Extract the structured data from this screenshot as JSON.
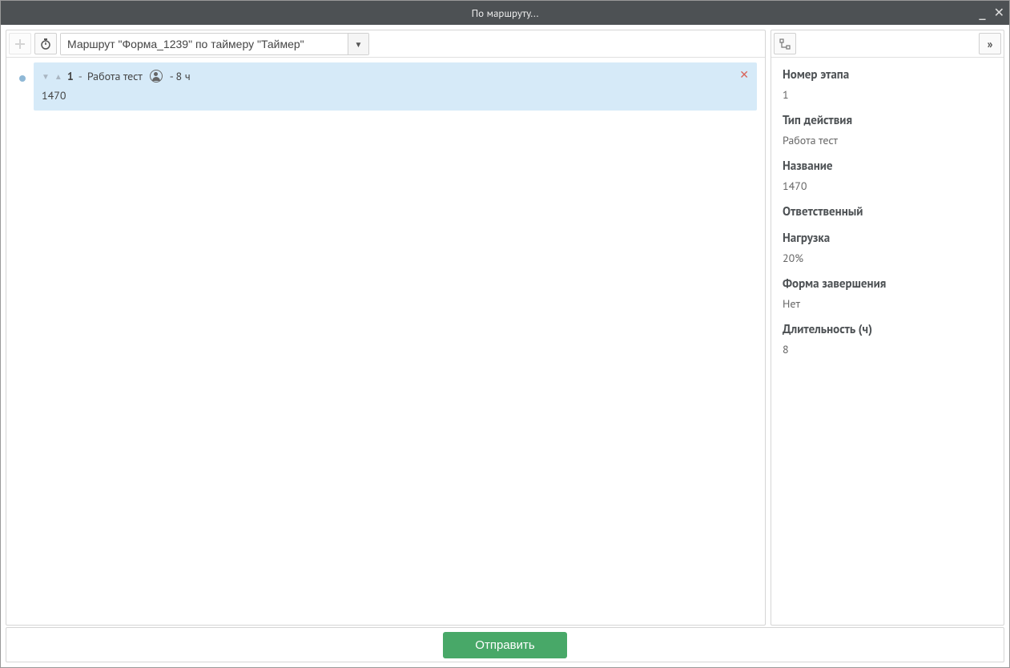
{
  "window": {
    "title": "По маршруту..."
  },
  "toolbar": {
    "route_label": "Маршрут \"Форма_1239\" по таймеру \"Таймер\""
  },
  "step": {
    "number": "1",
    "action_label": "Работа тест",
    "duration_label": "- 8 ч",
    "subtitle": "1470"
  },
  "details": {
    "stage_number": {
      "label": "Номер этапа",
      "value": "1"
    },
    "action_type": {
      "label": "Тип действия",
      "value": "Работа тест"
    },
    "name": {
      "label": "Название",
      "value": "1470"
    },
    "responsible": {
      "label": "Ответственный",
      "value": ""
    },
    "load": {
      "label": "Нагрузка",
      "value": "20%"
    },
    "completion_form": {
      "label": "Форма завершения",
      "value": "Нет"
    },
    "duration": {
      "label": "Длительность (ч)",
      "value": "8"
    }
  },
  "footer": {
    "submit_label": "Отправить"
  }
}
